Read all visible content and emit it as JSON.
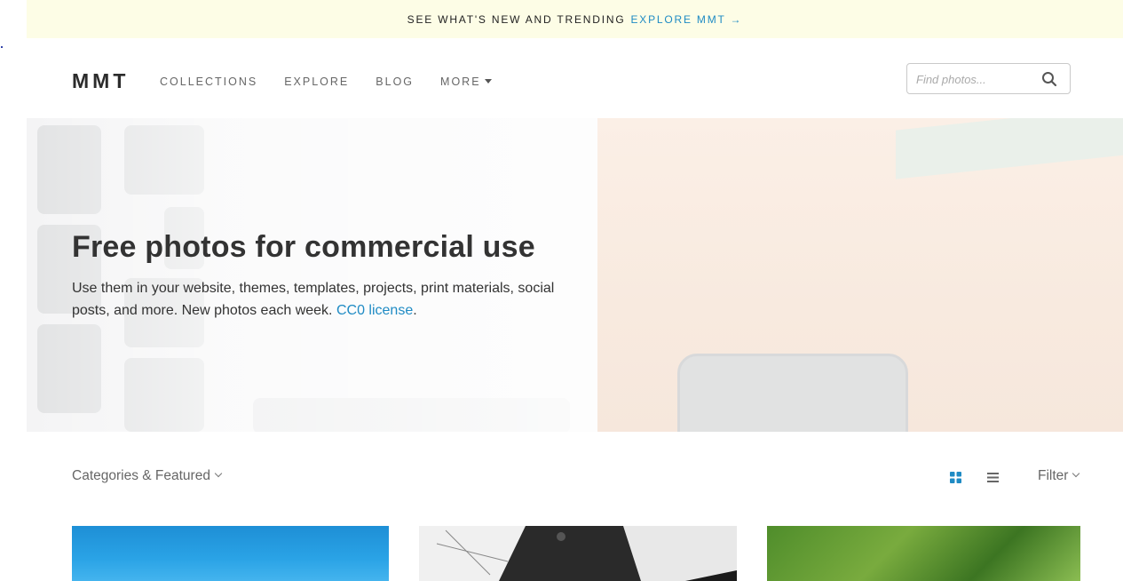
{
  "announcement": {
    "text": "SEE WHAT'S NEW AND TRENDING",
    "link": "EXPLORE MMT →"
  },
  "header": {
    "logo": "MMT",
    "nav": [
      {
        "label": "COLLECTIONS"
      },
      {
        "label": "EXPLORE"
      },
      {
        "label": "BLOG"
      },
      {
        "label": "MORE"
      }
    ],
    "search": {
      "placeholder": "Find photos...",
      "value": ""
    }
  },
  "hero": {
    "title": "Free photos for commercial use",
    "subtitle": "Use them in your website, themes, templates, projects, print materials, social posts, and more. New photos each week.",
    "license_link": "CC0 license",
    "period": "."
  },
  "toolbar": {
    "categories_label": "Categories & Featured",
    "filter_label": "Filter",
    "view_mode": "grid"
  },
  "colors": {
    "accent": "#1f8bc4",
    "announce_bg": "#fdfde6",
    "text": "#333333"
  },
  "icons": {
    "search": "search-icon",
    "grid": "grid-view-icon",
    "list": "list-view-icon",
    "caret": "caret-down-icon"
  }
}
